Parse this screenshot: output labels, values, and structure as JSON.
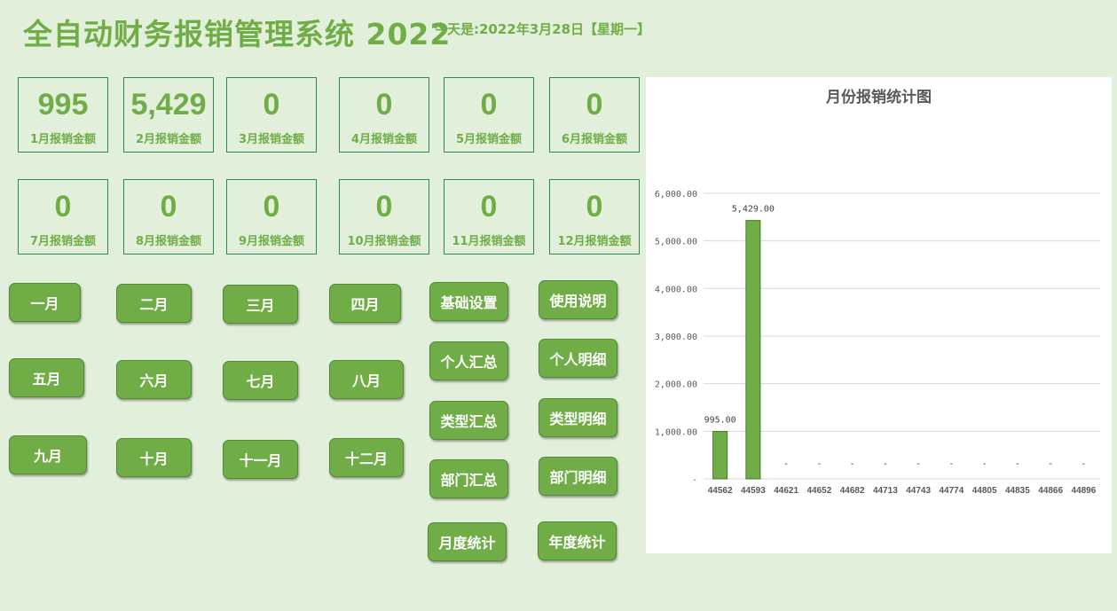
{
  "header": {
    "title": "全自动财务报销管理系统 2022",
    "date_text": "今天是:2022年3月28日【星期一】"
  },
  "cards": [
    {
      "value": "995",
      "label": "1月报销金额"
    },
    {
      "value": "5,429",
      "label": "2月报销金额"
    },
    {
      "value": "0",
      "label": "3月报销金额"
    },
    {
      "value": "0",
      "label": "4月报销金额"
    },
    {
      "value": "0",
      "label": "5月报销金额"
    },
    {
      "value": "0",
      "label": "6月报销金额"
    },
    {
      "value": "0",
      "label": "7月报销金额"
    },
    {
      "value": "0",
      "label": "8月报销金额"
    },
    {
      "value": "0",
      "label": "9月报销金额"
    },
    {
      "value": "0",
      "label": "10月报销金额"
    },
    {
      "value": "0",
      "label": "11月报销金额"
    },
    {
      "value": "0",
      "label": "12月报销金额"
    }
  ],
  "month_buttons": [
    "一月",
    "二月",
    "三月",
    "四月",
    "五月",
    "六月",
    "七月",
    "八月",
    "九月",
    "十月",
    "十一月",
    "十二月"
  ],
  "function_buttons": [
    "基础设置",
    "使用说明",
    "个人汇总",
    "个人明细",
    "类型汇总",
    "类型明细",
    "部门汇总",
    "部门明细",
    "月度统计",
    "年度统计"
  ],
  "colors": {
    "accent": "#70ad47",
    "background": "#e2efda",
    "card_border": "#2e8b57"
  },
  "chart_data": {
    "type": "bar",
    "title": "月份报销统计图",
    "categories": [
      "44562",
      "44593",
      "44621",
      "44652",
      "44682",
      "44713",
      "44743",
      "44774",
      "44805",
      "44835",
      "44866",
      "44896"
    ],
    "values": [
      995,
      5429,
      0,
      0,
      0,
      0,
      0,
      0,
      0,
      0,
      0,
      0
    ],
    "data_labels": [
      "995.00",
      "5,429.00",
      "-",
      "-",
      "-",
      "-",
      "-",
      "-",
      "-",
      "-",
      "-",
      "-"
    ],
    "y_ticks": [
      0,
      1000,
      2000,
      3000,
      4000,
      5000,
      6000
    ],
    "y_tick_labels": [
      "-",
      "1,000.00",
      "2,000.00",
      "3,000.00",
      "4,000.00",
      "5,000.00",
      "6,000.00"
    ],
    "ylim": [
      0,
      6000
    ],
    "grid": true,
    "bar_color": "#70ad47"
  }
}
